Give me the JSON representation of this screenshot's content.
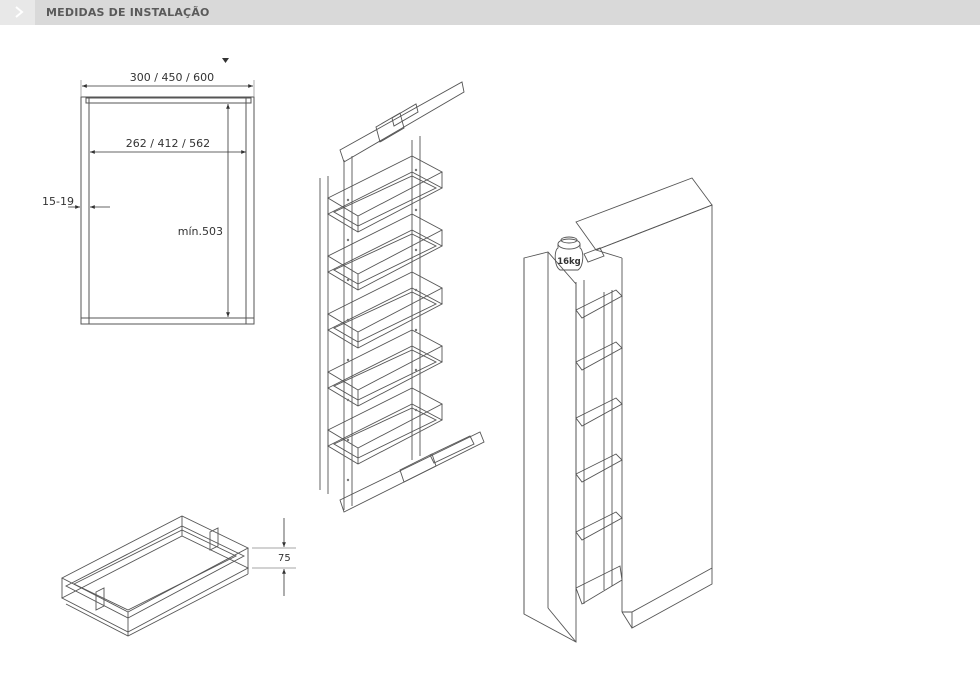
{
  "header": {
    "title": "MEDIDAS DE INSTALAÇÃO",
    "chevron_icon": "chevron-right-icon"
  },
  "dimensions": {
    "outer_width": "300 / 450 / 600",
    "inner_width": "262 / 412 / 562",
    "panel_thickness": "15-19",
    "min_height": "mín.503",
    "basket_height": "75"
  },
  "labels": {
    "load_weight": "16kg"
  },
  "colors": {
    "line": "#555555",
    "header_bg": "#d9d9d9"
  }
}
